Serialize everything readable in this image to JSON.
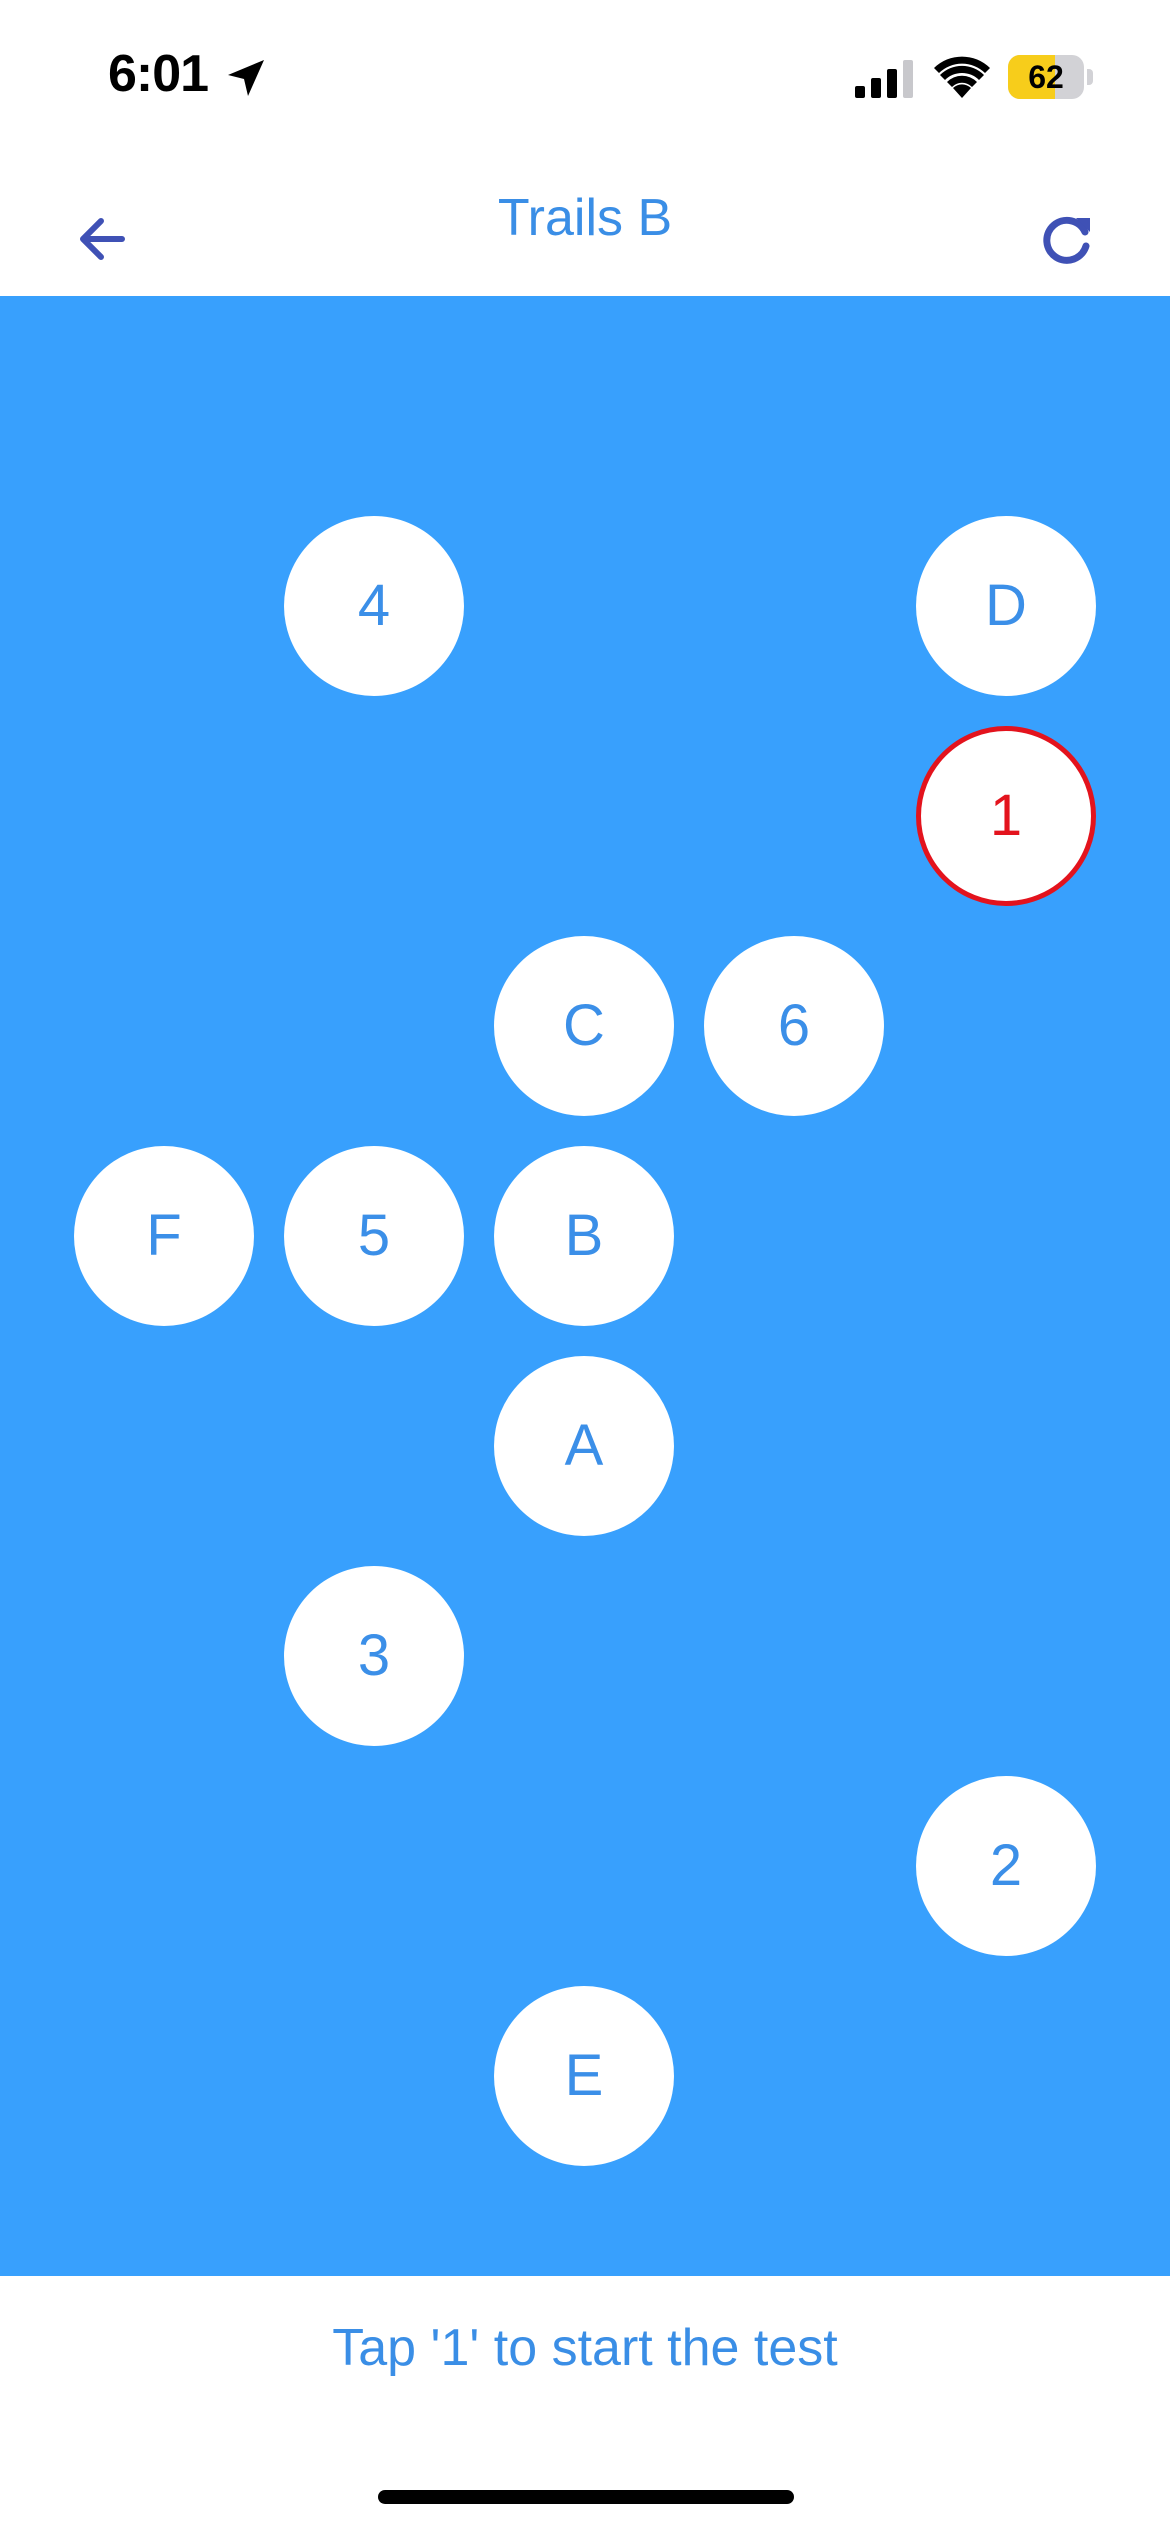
{
  "status_bar": {
    "time": "6:01",
    "battery_level": "62",
    "battery_fraction": 0.62
  },
  "nav": {
    "title": "Trails B",
    "back_icon": "arrow-left-icon",
    "refresh_icon": "refresh-icon"
  },
  "board": {
    "background_color": "#38a0fd",
    "node_color": "#ffffff",
    "node_text_color": "#3b8fe8",
    "start_color": "#e3131d",
    "nodes": [
      "4",
      "D",
      "1",
      "C",
      "6",
      "F",
      "5",
      "B",
      "A",
      "3",
      "2",
      "E"
    ],
    "start_node": "1"
  },
  "instruction": "Tap '1' to start the test"
}
